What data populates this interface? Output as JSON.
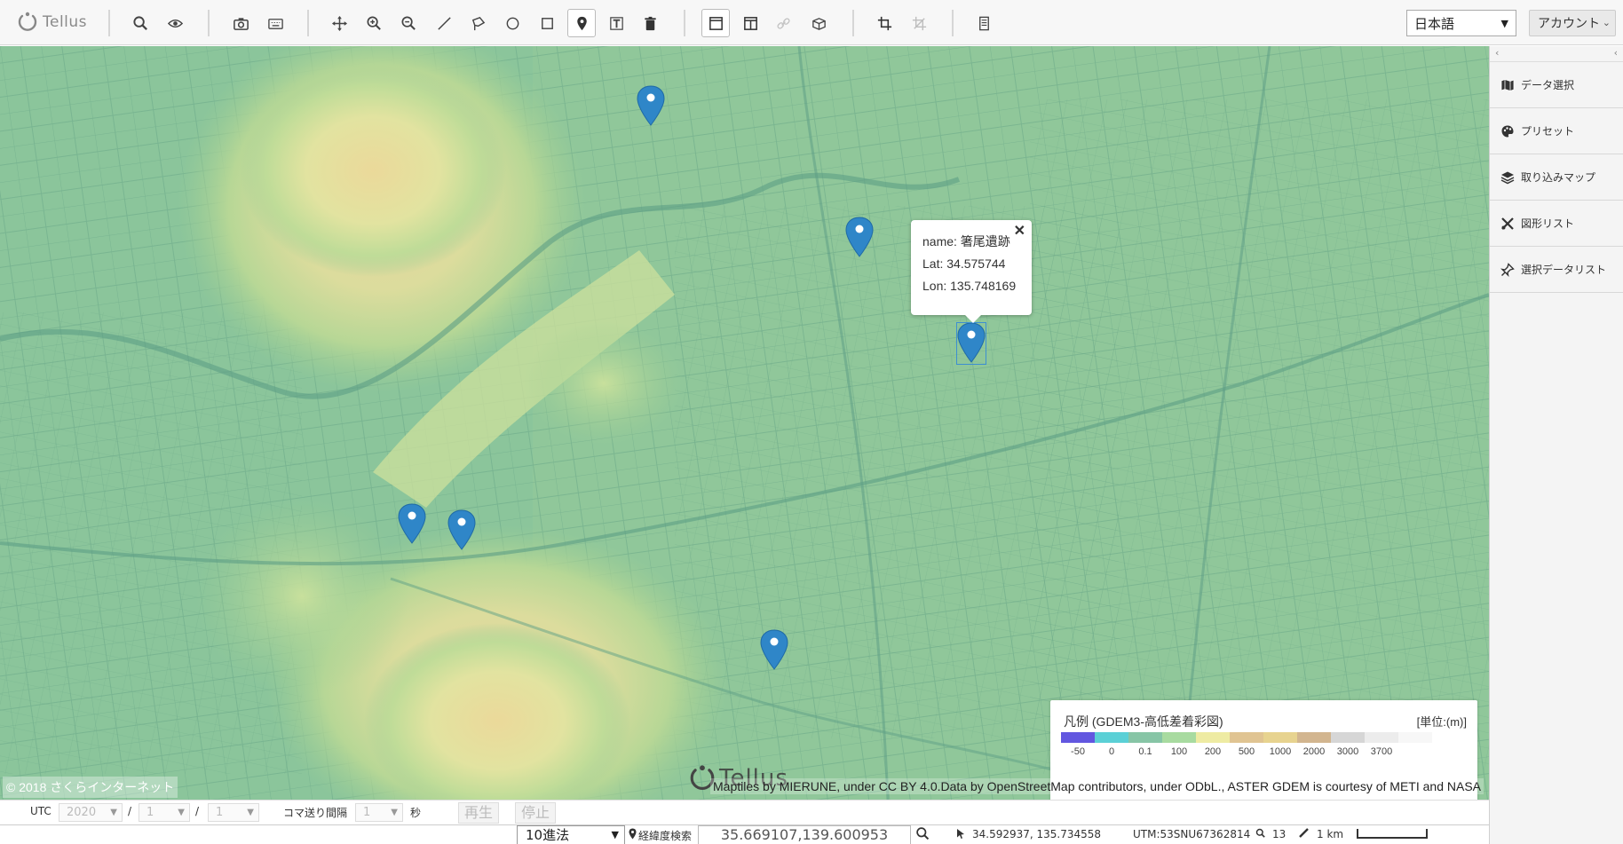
{
  "app": {
    "name": "Tellus"
  },
  "toolbar": {
    "language": "日本語",
    "account": "アカウント",
    "tools": [
      {
        "name": "search-icon"
      },
      {
        "name": "view-icon"
      },
      {
        "name": "camera-icon"
      },
      {
        "name": "keyboard-icon"
      },
      {
        "name": "pan-icon"
      },
      {
        "name": "zoom-in-icon"
      },
      {
        "name": "zoom-out-icon"
      },
      {
        "name": "line-icon"
      },
      {
        "name": "polygon-icon"
      },
      {
        "name": "circle-icon"
      },
      {
        "name": "rectangle-icon"
      },
      {
        "name": "marker-icon"
      },
      {
        "name": "text-icon"
      },
      {
        "name": "trash-icon"
      },
      {
        "name": "single-view-icon"
      },
      {
        "name": "split-view-icon"
      },
      {
        "name": "link-icon"
      },
      {
        "name": "3d-icon"
      },
      {
        "name": "crop-icon"
      },
      {
        "name": "crop-off-icon"
      },
      {
        "name": "notes-icon"
      }
    ]
  },
  "sidepanel": {
    "collapse_left": "‹",
    "collapse_right": "‹",
    "items": [
      {
        "label": "データ選択",
        "icon": "map-icon"
      },
      {
        "label": "プリセット",
        "icon": "palette-icon"
      },
      {
        "label": "取り込みマップ",
        "icon": "layers-icon"
      },
      {
        "label": "図形リスト",
        "icon": "shapes-icon"
      },
      {
        "label": "選択データリスト",
        "icon": "pin-list-icon"
      }
    ]
  },
  "map": {
    "popup": {
      "name_label": "name:",
      "name_value": "箸尾遺跡",
      "lat_label": "Lat:",
      "lat_value": "34.575744",
      "lon_label": "Lon:",
      "lon_value": "135.748169",
      "close": "✕"
    },
    "legend": {
      "title": "凡例 (GDEM3-高低差着彩図)",
      "unit": "[単位:(m)]",
      "colors": [
        "#6257e0",
        "#5bd0d6",
        "#87c5a6",
        "#a8dba0",
        "#eeeba3",
        "#e0c492",
        "#e7d38f",
        "#d2b58f",
        "#d6d6d6",
        "#ececec",
        "#f7f7f7"
      ],
      "ticks": [
        "-50",
        "0",
        "0.1",
        "100",
        "200",
        "500",
        "1000",
        "2000",
        "3000",
        "3700"
      ]
    },
    "copyright": "© 2018 さくらインターネット",
    "attribution": "Maptiles by MIERUNE, under CC BY 4.0.Data by OpenStreetMap contributors, under ODbL., ASTER GDEM is courtesy of METI and NASA",
    "watermark": "Tellus"
  },
  "timebar": {
    "utc": "UTC",
    "year": "2020",
    "sep1": "/",
    "month": "1",
    "sep2": "/",
    "day": "1",
    "interval_label": "コマ送り間隔",
    "interval_value": "1",
    "interval_unit": "秒",
    "play": "再生",
    "stop": "停止"
  },
  "statusbar": {
    "projection": "10進法",
    "coord_search_label": "経緯度検索",
    "coord_search_value": "35.669107,139.600953",
    "cursor_coords": "34.592937, 135.734558",
    "utm": "UTM:53SNU67362814",
    "zoom": "13",
    "scale": "1 km"
  }
}
